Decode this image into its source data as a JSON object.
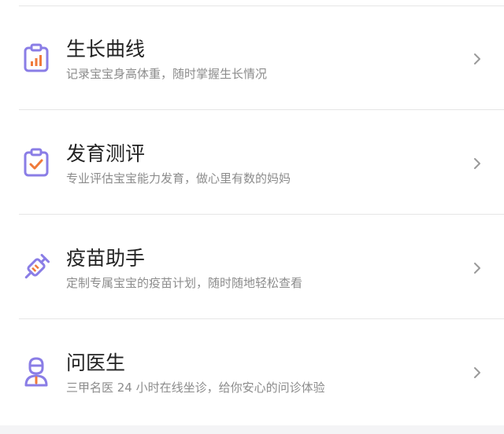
{
  "colors": {
    "icon_purple": "#8a7de6",
    "icon_orange": "#f07a3a",
    "title_text": "#222222",
    "desc_text": "#8c8c8c",
    "chevron": "#9a9a9a"
  },
  "menu": {
    "items": [
      {
        "icon": "growth-chart-icon",
        "title": "生长曲线",
        "description": "记录宝宝身高体重，随时掌握生长情况"
      },
      {
        "icon": "assessment-clipboard-icon",
        "title": "发育测评",
        "description": "专业评估宝宝能力发育，做心里有数的妈妈"
      },
      {
        "icon": "vaccine-syringe-icon",
        "title": "疫苗助手",
        "description": "定制专属宝宝的疫苗计划，随时随地轻松查看"
      },
      {
        "icon": "doctor-icon",
        "title": "问医生",
        "description": "三甲名医 24 小时在线坐诊，给你安心的问诊体验"
      }
    ]
  }
}
